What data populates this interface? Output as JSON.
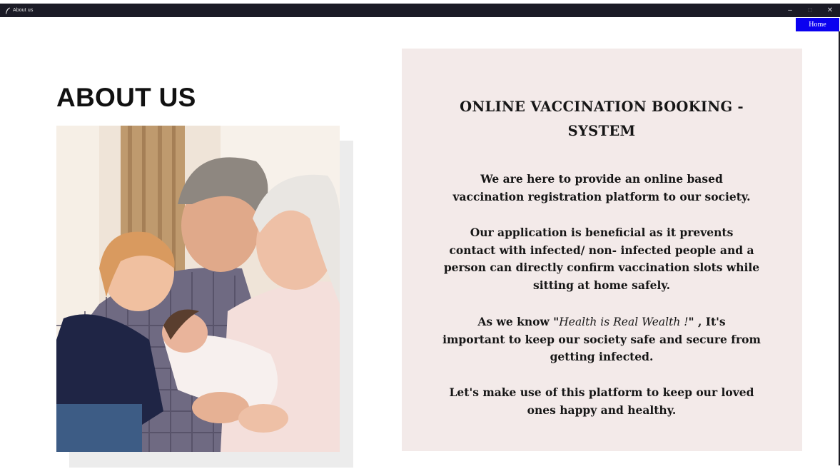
{
  "window": {
    "title": "About us",
    "controls": {
      "minimize": "–",
      "maximize": "□",
      "close": "✕"
    }
  },
  "nav": {
    "home_label": "Home"
  },
  "page": {
    "heading": "ABOUT US",
    "photo_alt": "Grandparents holding children"
  },
  "card": {
    "title_line1": "ONLINE  VACCINATION  BOOKING -",
    "title_line2": "SYSTEM",
    "p1_line1": "We are here to provide an online based",
    "p1_line2": "vaccination registration platform to our society.",
    "p2_line1": "Our application is beneficial as it prevents",
    "p2_line2": "contact with infected/ non- infected people and a",
    "p2_line3": "person can directly confirm vaccination slots while",
    "p2_line4": "sitting at home safely.",
    "p3_before": "As we know \"",
    "p3_quote": "Health is Real Wealth !",
    "p3_after": "\" , It's",
    "p3_line2": "important to keep our society safe and secure from",
    "p3_line3": "getting infected.",
    "p4_line1": "Let's make use of this platform to keep our loved",
    "p4_line2": "ones happy and healthy."
  },
  "colors": {
    "titlebar_bg": "#1b1b26",
    "home_button_bg": "#0a00f0",
    "card_bg": "#f3eae9"
  }
}
